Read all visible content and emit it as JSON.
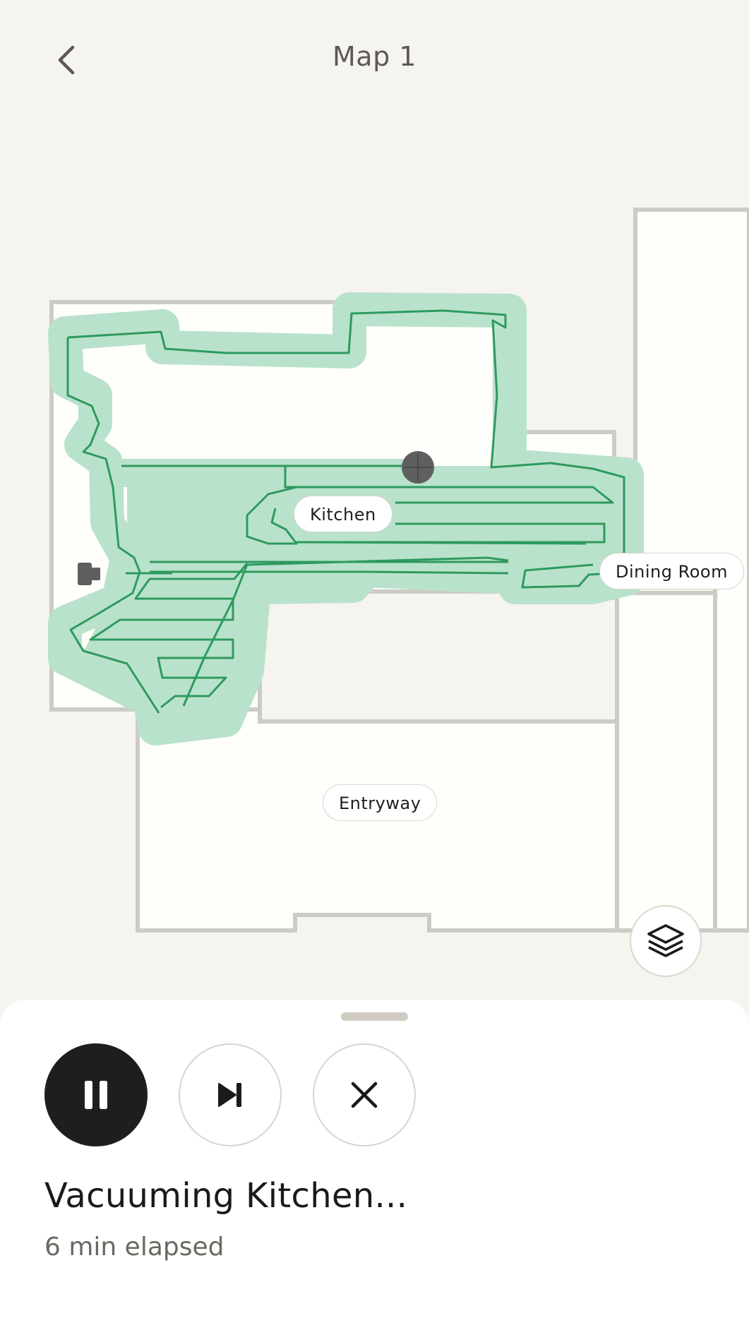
{
  "header": {
    "title": "Map 1",
    "back_icon": "chevron-left-icon"
  },
  "map": {
    "rooms": [
      {
        "id": "kitchen",
        "label": "Kitchen"
      },
      {
        "id": "dining-room",
        "label": "Dining Room"
      },
      {
        "id": "entryway",
        "label": "Entryway"
      }
    ],
    "layers_icon": "layers-icon",
    "colors": {
      "background": "#f6f4ef",
      "floor": "#fefefb",
      "walls": "#cdcbc6",
      "cleaned_area": "#b9e2cc",
      "path": "#2e9a5e",
      "robot": "#5f5f5f"
    }
  },
  "sheet": {
    "controls": {
      "pause_icon": "pause-icon",
      "skip_icon": "skip-next-icon",
      "cancel_icon": "close-icon"
    },
    "status": "Vacuuming Kitchen...",
    "elapsed": "6 min elapsed"
  }
}
